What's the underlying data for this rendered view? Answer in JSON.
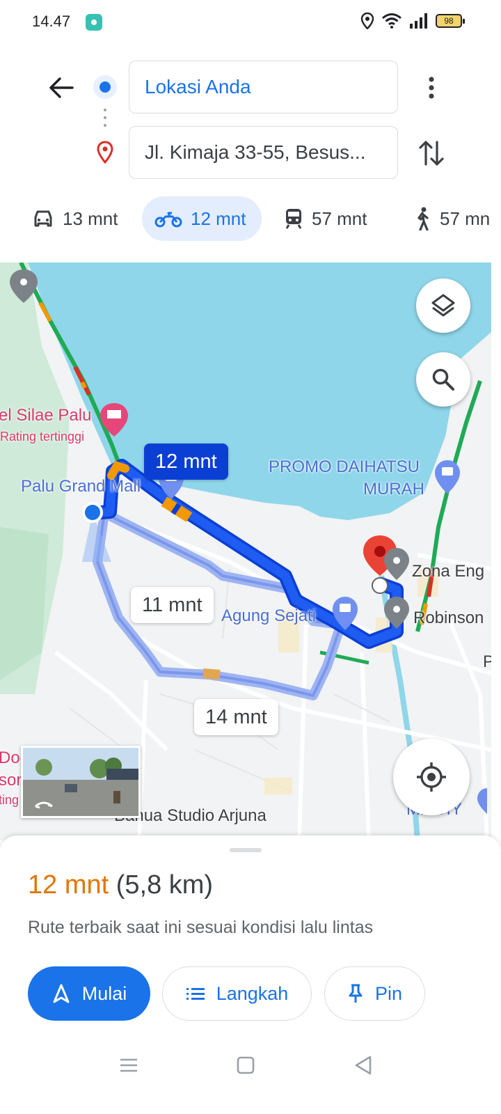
{
  "status_bar": {
    "time": "14.47",
    "battery": "98",
    "icons": [
      "location-icon",
      "wifi-icon",
      "signal-icon",
      "battery-icon"
    ]
  },
  "directions": {
    "origin": "Lokasi Anda",
    "destination": "Jl. Kimaja 33-55, Besus..."
  },
  "travel_modes": [
    {
      "mode": "car",
      "icon": "car-icon",
      "label": "13 mnt",
      "selected": false
    },
    {
      "mode": "motorcycle",
      "icon": "motorcycle-icon",
      "label": "12 mnt",
      "selected": true
    },
    {
      "mode": "transit",
      "icon": "train-icon",
      "label": "57 mnt",
      "selected": false
    },
    {
      "mode": "walk",
      "icon": "walking-icon",
      "label": "57 mn",
      "selected": false
    }
  ],
  "map": {
    "labels": {
      "hotel": "el Silae Palu",
      "hotel_sub": "Rating tertinggi",
      "mall": "Palu Grand Mall",
      "promo_line1": "PROMO DAIHATSU",
      "promo_line2": "MURAH",
      "agung": "Agung Sejati",
      "zona": "Zona Eng",
      "robinson": "Robinson",
      "studio": "Banua Studio Arjuna",
      "mr_diy": "Mr. DIY",
      "p_edge": "P",
      "edge_doc": "Doc",
      "edge_sor": "sor",
      "edge_ting": "ting"
    },
    "routes": {
      "primary": "12 mnt",
      "alt1": "11 mnt",
      "alt2": "14 mnt"
    },
    "colors": {
      "water": "#8fd6ea",
      "land": "#f1f3f4",
      "route_primary": "#1a4de8",
      "route_alt": "#9eb4f2",
      "traffic_green": "#1faa55",
      "traffic_orange": "#f29900",
      "traffic_red": "#d93025"
    }
  },
  "route_summary": {
    "time": "12 mnt",
    "distance": "(5,8 km)",
    "note": "Rute terbaik saat ini sesuai kondisi lalu lintas"
  },
  "actions": {
    "start": "Mulai",
    "steps": "Langkah",
    "pin": "Pin"
  }
}
